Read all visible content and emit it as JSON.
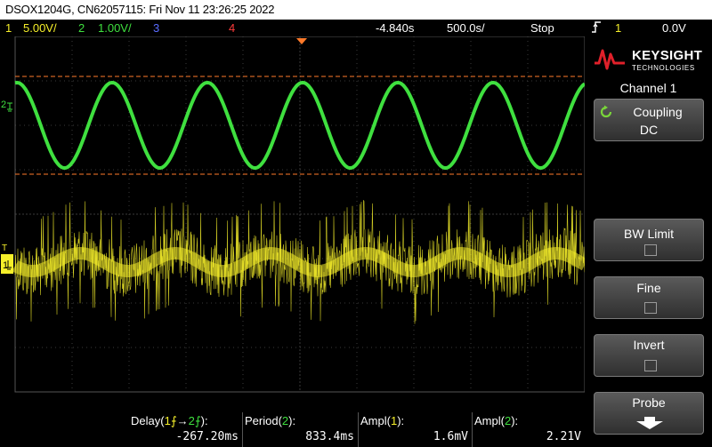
{
  "title": "DSOX1204G, CN62057115: Fri Nov 11 23:26:25 2022",
  "status": {
    "ch1_num": "1",
    "ch1_scale": "5.00V/",
    "ch2_num": "2",
    "ch2_scale": "1.00V/",
    "ch3_num": "3",
    "ch4_num": "4",
    "delay": "-4.840s",
    "timebase": "500.0s/",
    "run_state": "Stop",
    "trigger_icon": "trigger-edge-icon",
    "trigger_channel": "1",
    "trigger_level": "0.0V"
  },
  "colors": {
    "ch1": "#f5ef2a",
    "ch2": "#3fe03f",
    "ch3": "#5a6cff",
    "ch4": "#ff3b3b",
    "cursor": "#ff7a2a",
    "grid": "#3a3a3a"
  },
  "screen": {
    "ch2_marker": "2",
    "ch1_marker": "1",
    "trigger_marker": "T"
  },
  "panel": {
    "brand": "KEYSIGHT",
    "brand_sub": "TECHNOLOGIES",
    "title": "Channel 1",
    "softkeys": [
      {
        "label": "Coupling",
        "value": "DC",
        "icon": "cycle-icon"
      },
      {
        "label": "BW Limit",
        "checked": false
      },
      {
        "label": "Fine",
        "checked": false
      },
      {
        "label": "Invert",
        "checked": false
      },
      {
        "label": "Probe",
        "icon": "arrow-down-icon"
      }
    ]
  },
  "measurements": [
    {
      "name_prefix": "Delay(",
      "name_a": "1",
      "name_mid": "→",
      "name_b": "2",
      "name_suffix": "):",
      "value": "-267.20ms"
    },
    {
      "name_prefix": "Period(",
      "name_a": "2",
      "name_suffix": "):",
      "value": "833.4ms"
    },
    {
      "name_prefix": "Ampl(",
      "name_a": "1",
      "name_suffix": "):",
      "value": "1.6mV"
    },
    {
      "name_prefix": "Ampl(",
      "name_a": "2",
      "name_suffix": "):",
      "value": "2.21V"
    }
  ]
}
